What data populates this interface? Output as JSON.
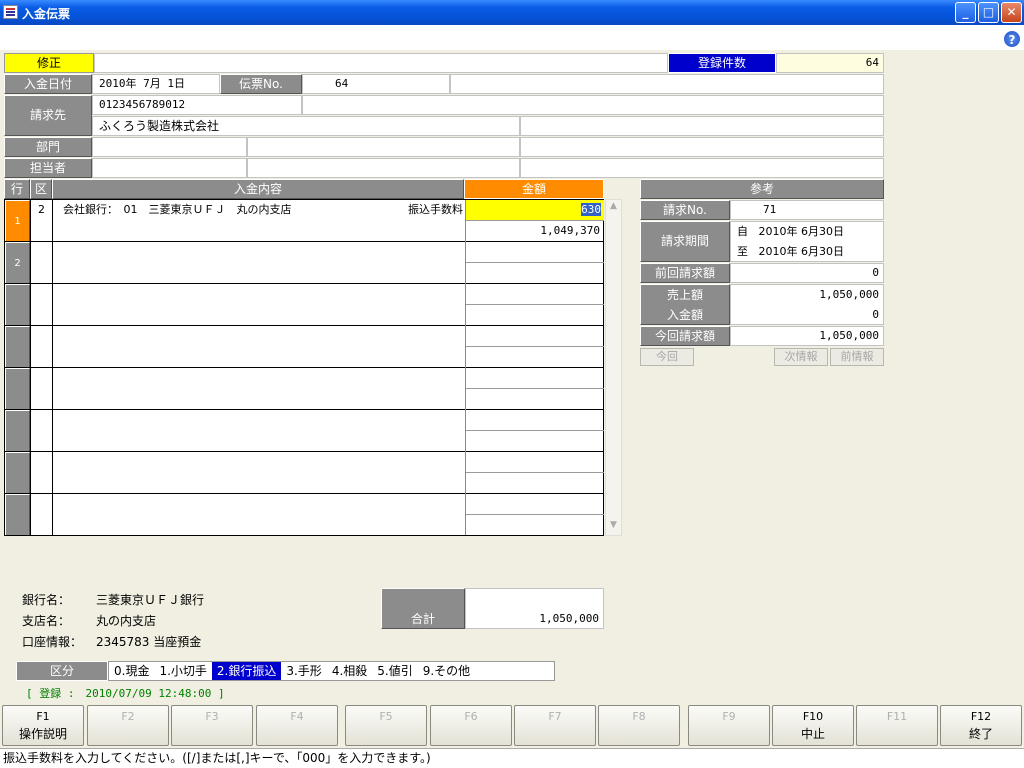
{
  "window": {
    "title": "入金伝票",
    "min": "_",
    "max": "□",
    "close": "✕",
    "help": "?"
  },
  "header": {
    "mode": "修正",
    "count_label": "登録件数",
    "count_value": "64"
  },
  "form": {
    "date_label": "入金日付",
    "date_value": "2010年 7月 1日",
    "slip_label": "伝票No.",
    "slip_value": "64",
    "billing_label": "請求先",
    "billing_code": "0123456789012",
    "billing_name": "ふくろう製造株式会社",
    "dept_label": "部門",
    "staff_label": "担当者"
  },
  "grid": {
    "col_row": "行",
    "col_kind": "区",
    "col_content": "入金内容",
    "col_amount": "金額",
    "rows": [
      {
        "no": "1",
        "kind": "2",
        "content": "会社銀行：　01　三菱東京ＵＦＪ　丸の内支店",
        "fee_label": "振込手数料",
        "fee": "630",
        "amount": "1,049,370"
      },
      {
        "no": "2",
        "kind": "",
        "content": "",
        "amount": ""
      },
      {
        "no": "",
        "kind": "",
        "content": "",
        "amount": ""
      },
      {
        "no": "",
        "kind": "",
        "content": "",
        "amount": ""
      },
      {
        "no": "",
        "kind": "",
        "content": "",
        "amount": ""
      },
      {
        "no": "",
        "kind": "",
        "content": "",
        "amount": ""
      },
      {
        "no": "",
        "kind": "",
        "content": "",
        "amount": ""
      },
      {
        "no": "",
        "kind": "",
        "content": "",
        "amount": ""
      }
    ]
  },
  "ref": {
    "title": "参考",
    "invoice_label": "請求No.",
    "invoice_value": "71",
    "period_label": "請求期間",
    "from": "自",
    "from_date": "2010年 6月30日",
    "to": "至",
    "to_date": "2010年 6月30日",
    "prev_label": "前回請求額",
    "prev_value": "0",
    "sales_label": "売上額",
    "sales_value": "1,050,000",
    "payment_label": "入金額",
    "payment_value": "0",
    "current_label": "今回請求額",
    "current_value": "1,050,000",
    "btn_this": "今回",
    "btn_next": "次情報",
    "btn_prev": "前情報"
  },
  "bank": {
    "name_label": "銀行名：",
    "name": "三菱東京ＵＦＪ銀行",
    "branch_label": "支店名：",
    "branch": "丸の内支店",
    "account_label": "口座情報：",
    "account": "2345783 当座預金"
  },
  "total": {
    "label": "合計",
    "value": "1,050,000"
  },
  "division": {
    "label": "区分",
    "options": [
      "0.現金",
      "1.小切手",
      "2.銀行振込",
      "3.手形",
      "4.相殺",
      "5.値引",
      "9.その他"
    ]
  },
  "register": "[ 登録 :　2010/07/09 12:48:00 ]",
  "fkeys": [
    {
      "key": "F1",
      "label": "操作説明"
    },
    {
      "key": "F2",
      "label": ""
    },
    {
      "key": "F3",
      "label": ""
    },
    {
      "key": "F4",
      "label": ""
    },
    {
      "key": "F5",
      "label": ""
    },
    {
      "key": "F6",
      "label": ""
    },
    {
      "key": "F7",
      "label": ""
    },
    {
      "key": "F8",
      "label": ""
    },
    {
      "key": "F9",
      "label": ""
    },
    {
      "key": "F10",
      "label": "中止"
    },
    {
      "key": "F11",
      "label": ""
    },
    {
      "key": "F12",
      "label": "終了"
    }
  ],
  "status": "振込手数料を入力してください。([/]または[,]キーで、「000」を入力できます。)",
  "colors": {
    "titlebar": "#0a5ce6",
    "mode": "#ffff00",
    "count": "#0000cc",
    "amount_header": "#ff8c00",
    "selected": "#0000cc",
    "row_active": "#ff8c00"
  }
}
